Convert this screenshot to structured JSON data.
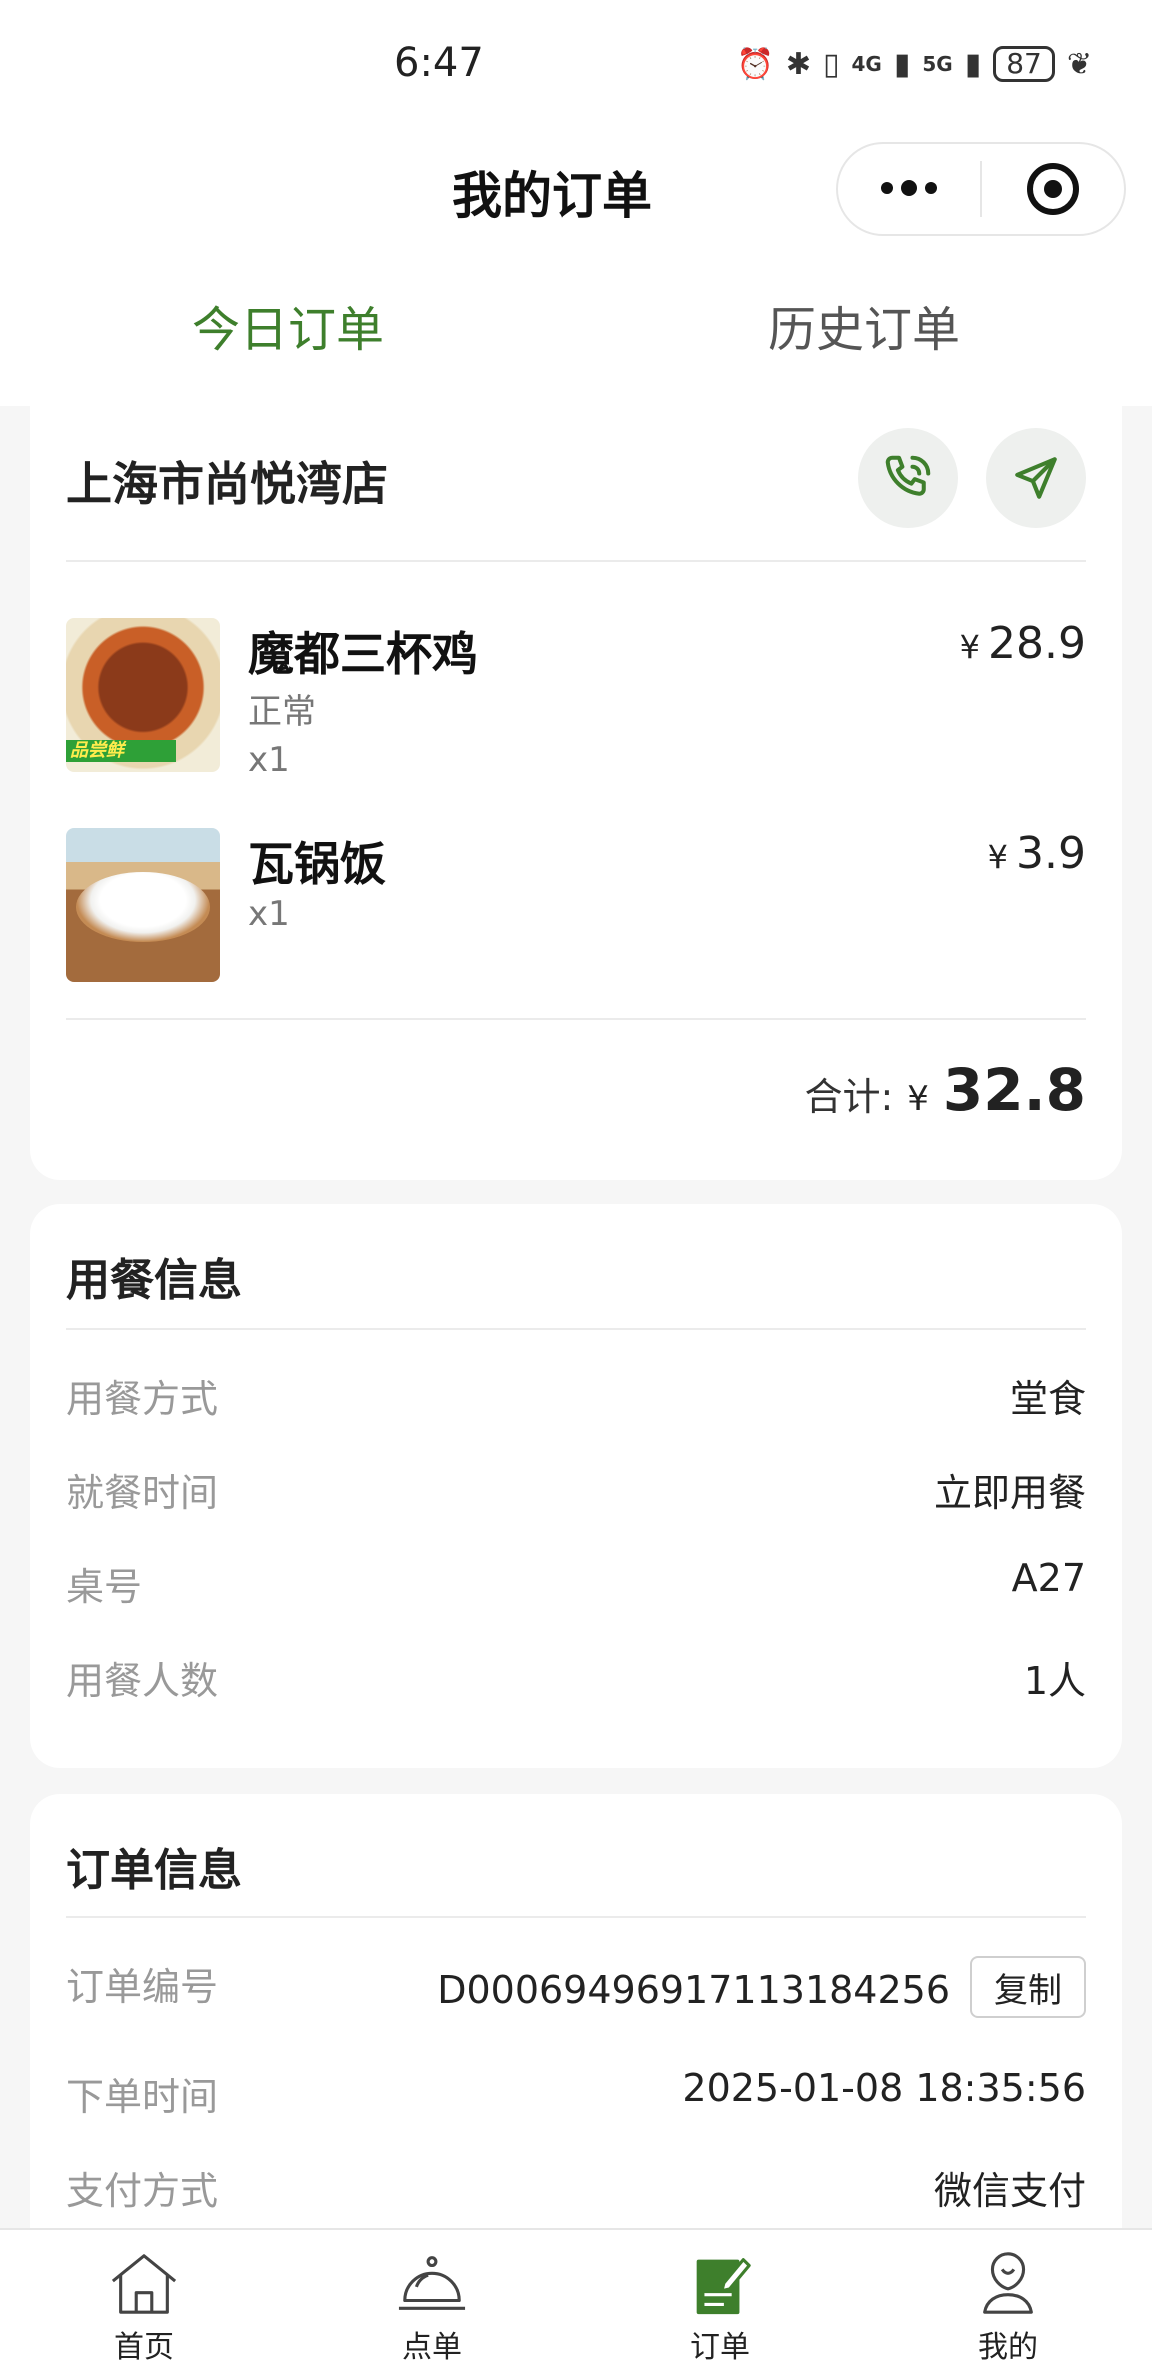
{
  "status_bar": {
    "time": "6:47",
    "signal_4g": "4G",
    "signal_5g": "5G",
    "battery": "87"
  },
  "header": {
    "title": "我的订单"
  },
  "tabs": {
    "today": "今日订单",
    "history": "历史订单"
  },
  "store": {
    "name": "上海市尚悦湾店",
    "items": [
      {
        "name": "魔都三杯鸡",
        "spec": "正常",
        "qty": "x1",
        "currency": "¥",
        "price": "28.9",
        "badge": "品尝鲜"
      },
      {
        "name": "瓦锅饭",
        "qty": "x1",
        "currency": "¥",
        "price": "3.9"
      }
    ],
    "total_label": "合计:",
    "total_currency": "¥",
    "total_amount": "32.8"
  },
  "dining": {
    "title": "用餐信息",
    "rows": [
      {
        "key": "用餐方式",
        "value": "堂食"
      },
      {
        "key": "就餐时间",
        "value": "立即用餐"
      },
      {
        "key": "桌号",
        "value": "A27"
      },
      {
        "key": "用餐人数",
        "value": "1人"
      }
    ]
  },
  "order_info": {
    "title": "订单信息",
    "order_no_label": "订单编号",
    "order_no": "D0006949691711318425​6",
    "copy_label": "复制",
    "time_label": "下单时间",
    "time": "2025-01-08 18:35:56",
    "pay_label": "支付方式",
    "pay": "微信支付"
  },
  "tabbar": [
    {
      "label": "首页",
      "icon": "home-icon"
    },
    {
      "label": "点单",
      "icon": "cloche-icon"
    },
    {
      "label": "订单",
      "icon": "order-icon"
    },
    {
      "label": "我的",
      "icon": "profile-icon"
    }
  ],
  "colors": {
    "accent": "#3e7f2c",
    "background": "#f6f6f6"
  }
}
